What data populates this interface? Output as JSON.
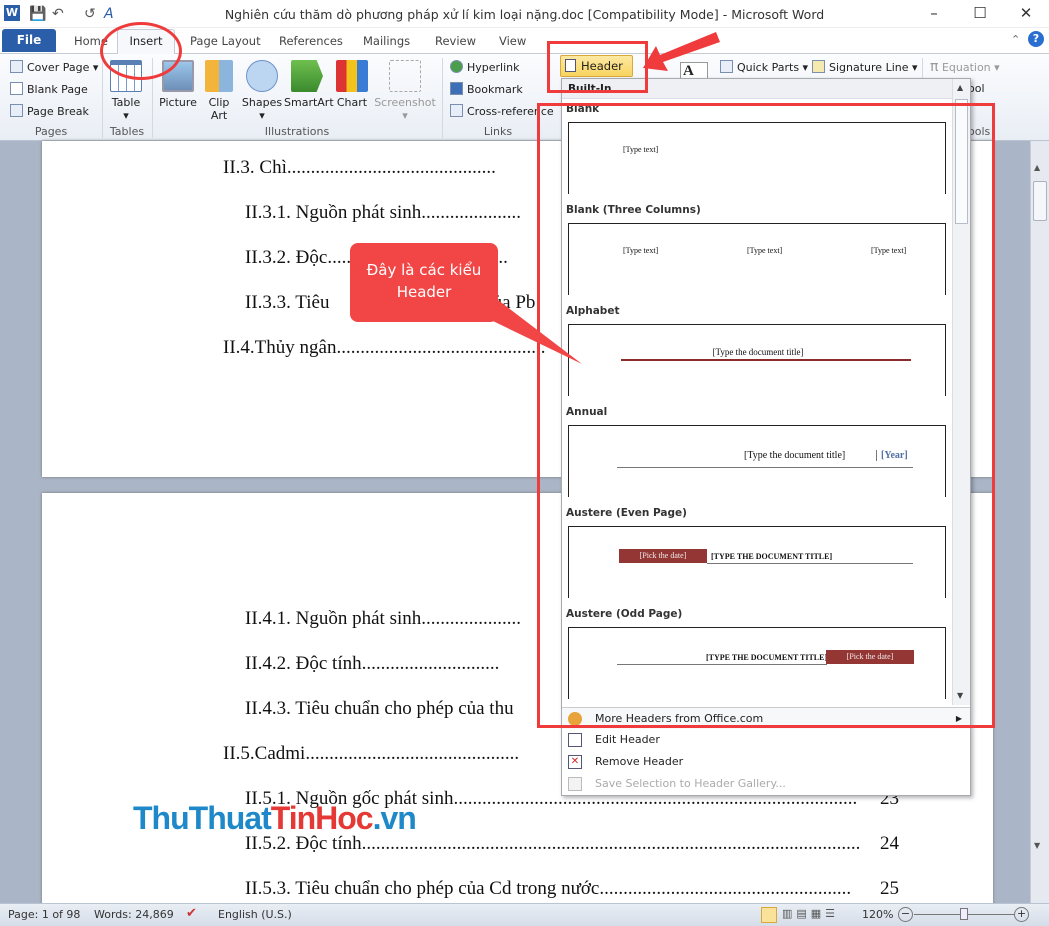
{
  "window": {
    "title": "Nghiên cứu thăm dò phương pháp xử lí kim loại nặng.doc [Compatibility Mode] - Microsoft Word",
    "minimize": "–",
    "maximize": "☐",
    "close": "✕"
  },
  "tabs": [
    "File",
    "Home",
    "Insert",
    "Page Layout",
    "References",
    "Mailings",
    "Review",
    "View"
  ],
  "ribbon": {
    "pages": {
      "items": [
        "Cover Page",
        "Blank Page",
        "Page Break"
      ],
      "label": "Pages"
    },
    "tables": {
      "table": "Table",
      "label": "Tables"
    },
    "illustrations": {
      "items": [
        "Picture",
        "Clip Art",
        "Shapes",
        "SmartArt",
        "Chart",
        "Screenshot"
      ],
      "label": "Illustrations"
    },
    "links": {
      "items": [
        "Hyperlink",
        "Bookmark",
        "Cross-reference"
      ],
      "label": "Links"
    },
    "header_button": "Header",
    "text": {
      "quick_parts": "Quick Parts",
      "signature_line": "Signature Line"
    },
    "symbols": {
      "equation": "Equation",
      "symbol": "ool",
      "label": "ools"
    }
  },
  "dropdown": {
    "section": "Built-In",
    "gallery": [
      {
        "name": "Blank",
        "texts": [
          "[Type text]"
        ]
      },
      {
        "name": "Blank (Three Columns)",
        "texts": [
          "[Type text]",
          "[Type text]",
          "[Type text]"
        ]
      },
      {
        "name": "Alphabet",
        "texts": [
          "[Type the document title]"
        ]
      },
      {
        "name": "Annual",
        "texts": [
          "[Type the document title]",
          "[Year]"
        ]
      },
      {
        "name": "Austere (Even Page)",
        "texts": [
          "[Pick the date]",
          "[TYPE THE DOCUMENT TITLE]"
        ]
      },
      {
        "name": "Austere (Odd Page)",
        "texts": [
          "[TYPE THE DOCUMENT TITLE]",
          "[Pick the date]"
        ]
      }
    ],
    "menu": [
      "More Headers from Office.com",
      "Edit Header",
      "Remove Header",
      "Save Selection to Header Gallery..."
    ]
  },
  "document": {
    "page1": [
      "II.3. Chì",
      "II.3.1. Nguồn phát sinh",
      "II.3.2. Độc",
      "II.3.3. Tiêu",
      "của Pb",
      "II.4.Thủy ngân"
    ],
    "page2": [
      {
        "text": "II.4.1. Nguồn phát sinh",
        "page": ""
      },
      {
        "text": "II.4.2. Độc tính",
        "page": ""
      },
      {
        "text": "II.4.3. Tiêu chuẩn cho phép  của thu",
        "page": ""
      },
      {
        "text": "II.5.Cadmi",
        "page": ""
      },
      {
        "text": "II.5.1. Nguồn gốc phát sinh",
        "page": "23"
      },
      {
        "text": "II.5.2. Độc tính",
        "page": "24"
      },
      {
        "text": "II.5.3. Tiêu chuẩn cho phép của Cd trong nước",
        "page": "25"
      }
    ]
  },
  "annotation": {
    "callout": "Đây là các kiểu Header",
    "watermark": {
      "part1": "ThuThuat",
      "part2": "TinHoc",
      "part3": ".vn"
    }
  },
  "status": {
    "page": "Page: 1 of 98",
    "words": "Words: 24,869",
    "language": "English (U.S.)",
    "zoom": "120%",
    "zoom_level_percent": 120
  },
  "colors": {
    "accent": "#2a5ea8",
    "annotation_red": "#ef3b3b",
    "header_button": "#f8d55f"
  }
}
